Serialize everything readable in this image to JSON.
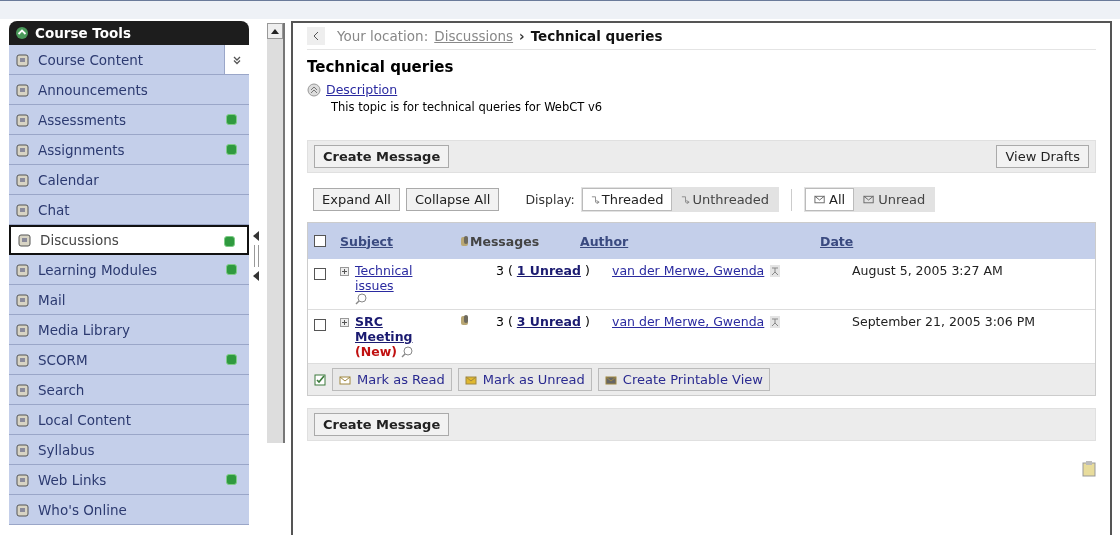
{
  "sidebar": {
    "title": "Course Tools",
    "items": [
      {
        "label": "Course Content",
        "badge": false,
        "selected": false,
        "expander": true
      },
      {
        "label": "Announcements",
        "badge": false,
        "selected": false
      },
      {
        "label": "Assessments",
        "badge": true,
        "selected": false
      },
      {
        "label": "Assignments",
        "badge": true,
        "selected": false
      },
      {
        "label": "Calendar",
        "badge": false,
        "selected": false
      },
      {
        "label": "Chat",
        "badge": false,
        "selected": false
      },
      {
        "label": "Discussions",
        "badge": true,
        "selected": true
      },
      {
        "label": "Learning Modules",
        "badge": true,
        "selected": false
      },
      {
        "label": "Mail",
        "badge": false,
        "selected": false
      },
      {
        "label": "Media Library",
        "badge": false,
        "selected": false
      },
      {
        "label": "SCORM",
        "badge": true,
        "selected": false
      },
      {
        "label": "Search",
        "badge": false,
        "selected": false
      },
      {
        "label": "Local Content",
        "badge": false,
        "selected": false
      },
      {
        "label": "Syllabus",
        "badge": false,
        "selected": false
      },
      {
        "label": "Web Links",
        "badge": true,
        "selected": false
      },
      {
        "label": "Who's Online",
        "badge": false,
        "selected": false
      }
    ]
  },
  "breadcrumb": {
    "prefix": "Your location:",
    "link": "Discussions",
    "separator": "›",
    "current": "Technical queries"
  },
  "topic": {
    "title": "Technical queries",
    "description_link": "Description",
    "description": "This topic is for technical queries for WebCT v6"
  },
  "top_toolbar": {
    "create": "Create Message",
    "drafts": "View Drafts"
  },
  "filters": {
    "expand": "Expand All",
    "collapse": "Collapse All",
    "display_label": "Display:",
    "display": [
      {
        "label": "Threaded",
        "selected": true
      },
      {
        "label": "Unthreaded",
        "selected": false
      }
    ],
    "show": [
      {
        "label": "All",
        "selected": true
      },
      {
        "label": "Unread",
        "selected": false
      }
    ]
  },
  "table": {
    "select_all": false,
    "columns": [
      "Subject",
      "Messages",
      "Author",
      "Date"
    ],
    "rows": [
      {
        "checked": false,
        "subject": "Technical issues",
        "unread": false,
        "new_label": "",
        "attachment": false,
        "messages": "3 (",
        "unread_link": "1 Unread",
        "messages_end": ")",
        "author": "van der Merwe, Gwenda",
        "date": "August 5, 2005 3:27 AM"
      },
      {
        "checked": false,
        "subject": "SRC Meeting",
        "unread": true,
        "new_label": "(New)",
        "attachment": true,
        "messages": "3 (",
        "unread_link": "3 Unread",
        "messages_end": ")",
        "author": "van der Merwe, Gwenda",
        "date": "September 21, 2005 3:06 PM"
      }
    ]
  },
  "actions": [
    "Mark as Read",
    "Mark as Unread",
    "Create Printable View"
  ],
  "bottom_toolbar": {
    "create": "Create Message"
  }
}
